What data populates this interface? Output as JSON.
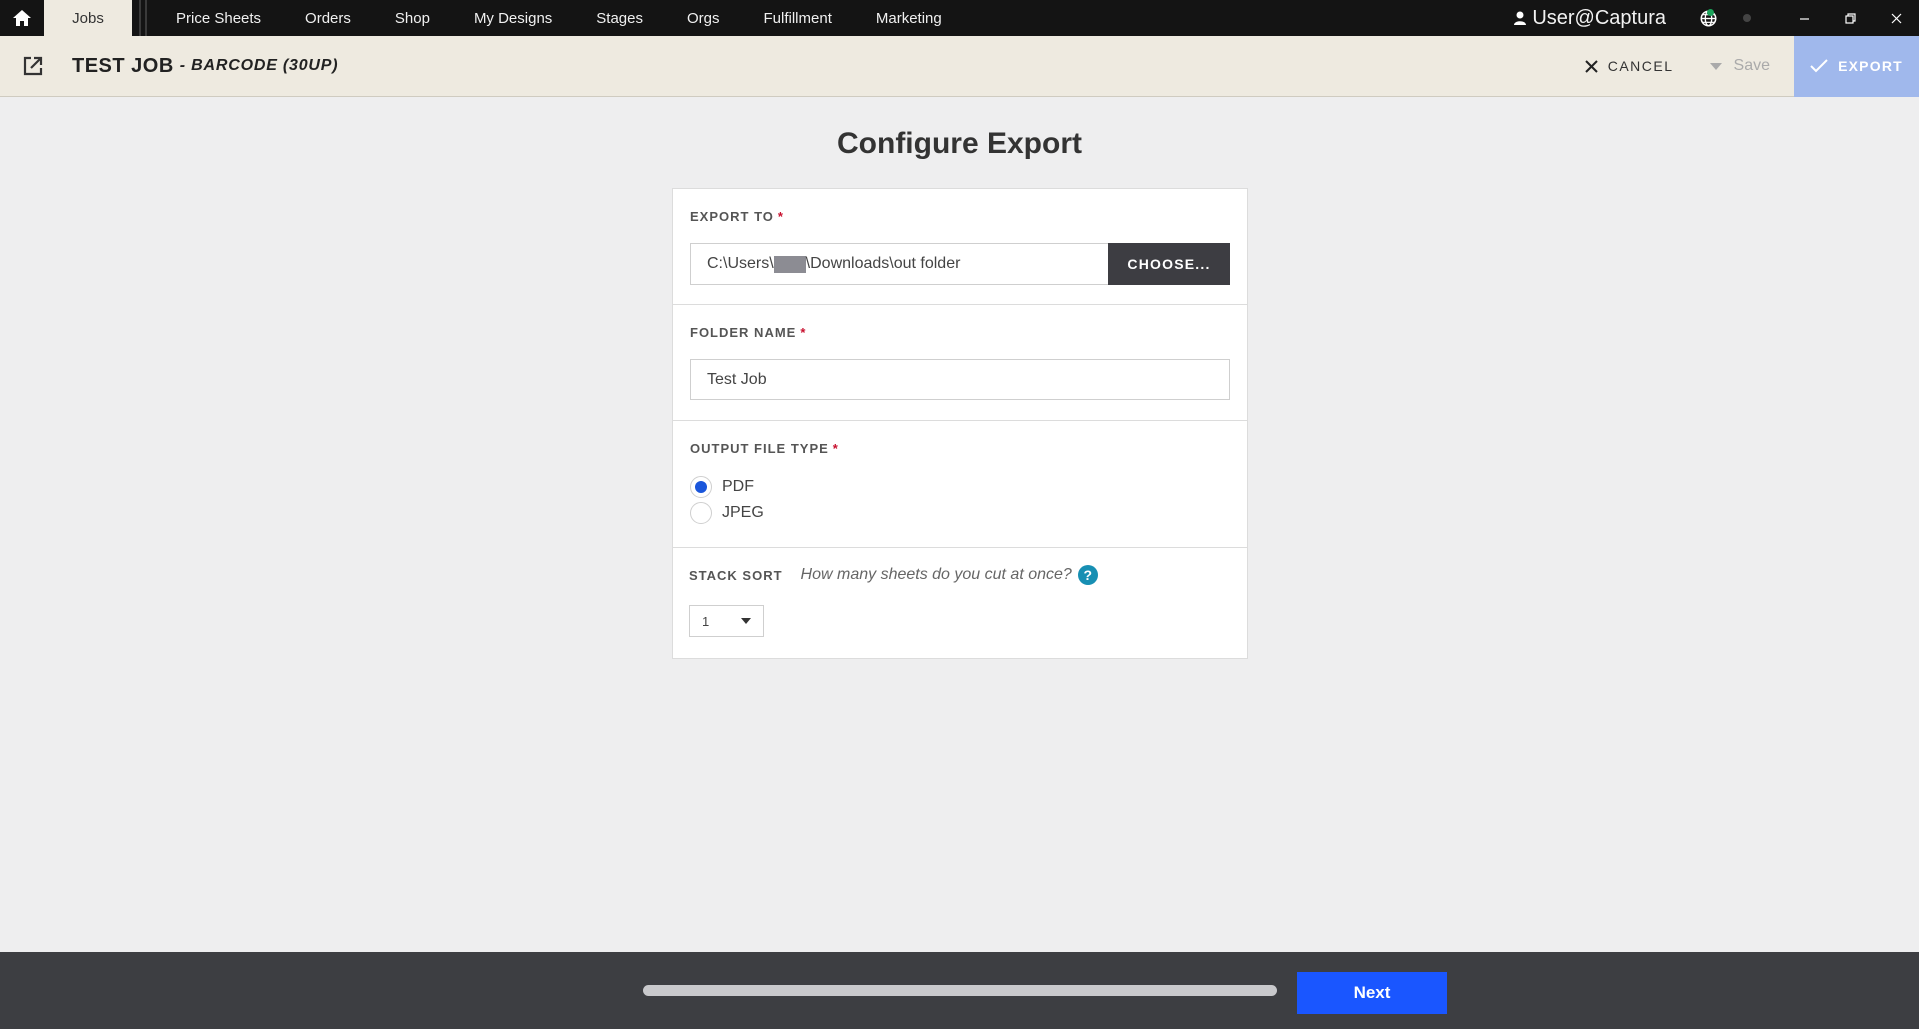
{
  "nav": {
    "tabs": [
      {
        "label": "Jobs",
        "active": true
      },
      {
        "label": "Price Sheets"
      },
      {
        "label": "Orders"
      },
      {
        "label": "Shop"
      },
      {
        "label": "My Designs"
      },
      {
        "label": "Stages"
      },
      {
        "label": "Orgs"
      },
      {
        "label": "Fulfillment"
      },
      {
        "label": "Marketing"
      }
    ],
    "user": "User@Captura",
    "icons": [
      "home-icon",
      "user-icon",
      "globe-icon",
      "minimize-icon",
      "restore-icon",
      "close-icon"
    ]
  },
  "job": {
    "title": "TEST JOB",
    "subtitle": "- BARCODE (30UP)",
    "cancel_label": "CANCEL",
    "save_label": "Save",
    "export_label": "EXPORT"
  },
  "main": {
    "title": "Configure Export",
    "export_to": {
      "label": "EXPORT TO",
      "required": "*",
      "path_prefix": "C:\\Users\\",
      "path_suffix": "\\Downloads\\out folder",
      "choose_label": "CHOOSE..."
    },
    "folder_name": {
      "label": "FOLDER NAME",
      "required": "*",
      "value": "Test Job"
    },
    "output_file_type": {
      "label": "OUTPUT FILE TYPE",
      "required": "*",
      "options": [
        {
          "label": "PDF",
          "selected": true
        },
        {
          "label": "JPEG",
          "selected": false
        }
      ]
    },
    "stack_sort": {
      "label": "STACK SORT",
      "hint": "How many sheets do you cut at once?",
      "help_glyph": "?",
      "selected_value": "1"
    }
  },
  "footer": {
    "next_label": "Next",
    "progress_fraction": 1.0
  },
  "colors": {
    "topbar": "#141414",
    "jobbar": "#eeeae0",
    "export_button": "#a0b8ec",
    "next_button": "#1a56ff",
    "radio_checked": "#1a56db",
    "required": "#c8102e",
    "help": "#178fb3",
    "footer": "#3d3e42"
  }
}
